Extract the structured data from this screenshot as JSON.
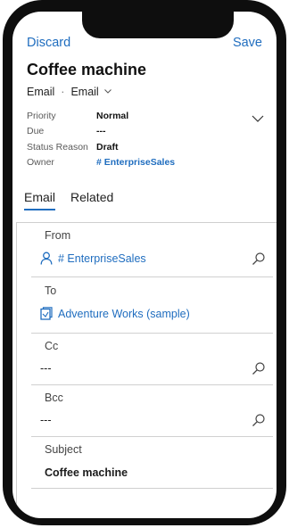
{
  "toolbar": {
    "discard_label": "Discard",
    "save_label": "Save"
  },
  "record": {
    "title": "Coffee machine",
    "entity_type": "Email",
    "form_name": "Email"
  },
  "summary": {
    "priority_label": "Priority",
    "priority_value": "Normal",
    "due_label": "Due",
    "due_value": "---",
    "status_label": "Status Reason",
    "status_value": "Draft",
    "owner_label": "Owner",
    "owner_value": "# EnterpriseSales"
  },
  "tabs": [
    {
      "label": "Email",
      "active": true
    },
    {
      "label": "Related",
      "active": false
    }
  ],
  "form": {
    "from": {
      "label": "From",
      "value": "# EnterpriseSales",
      "icon": "user-icon"
    },
    "to": {
      "label": "To",
      "value": "Adventure Works (sample)",
      "icon": "account-icon"
    },
    "cc": {
      "label": "Cc",
      "value": "---"
    },
    "bcc": {
      "label": "Bcc",
      "value": "---"
    },
    "subject": {
      "label": "Subject",
      "value": "Coffee machine"
    }
  },
  "colors": {
    "accent": "#1f6dbf",
    "frame": "#0e0e0e"
  }
}
